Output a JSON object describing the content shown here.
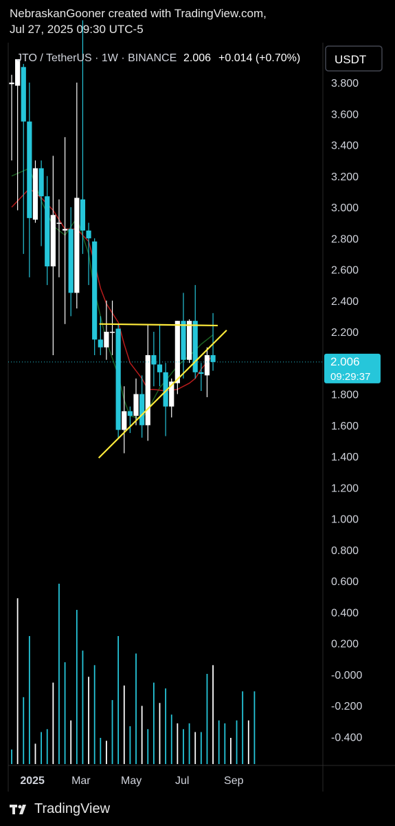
{
  "header": {
    "attribution": "NebraskanGooner created with TradingView.com,",
    "timestamp": "Jul 27, 2025 09:30 UTC-5"
  },
  "legend": {
    "symbol_text": "JTO / TetherUS · 1W · BINANCE",
    "last": "2.006",
    "change": "+0.014 (+0.70%)"
  },
  "currency_button": "USDT",
  "price_label": {
    "value": "2.006",
    "countdown": "09:29:37"
  },
  "footer": {
    "brand": "TradingView"
  },
  "colors": {
    "up": "#26c6da",
    "down": "#ffffff",
    "ma_red": "#b71c1c",
    "ma_green": "#1b5e20",
    "trendline": "#ffeb3b",
    "axis_text": "#d1d4dc",
    "background": "#000000"
  },
  "chart_data": {
    "type": "candlestick",
    "symbol": "JTO / TetherUS",
    "interval": "1W",
    "exchange": "BINANCE",
    "y_ticks": [
      "3.800",
      "3.600",
      "3.400",
      "3.200",
      "3.000",
      "2.800",
      "2.600",
      "2.400",
      "2.200",
      "2.000",
      "1.800",
      "1.600",
      "1.400",
      "1.200",
      "1.000",
      "0.800",
      "0.600",
      "0.400",
      "0.200",
      "-0.000",
      "-0.200",
      "-0.400"
    ],
    "ylim": [
      -0.55,
      4.0
    ],
    "x_ticks": [
      {
        "label": "2025",
        "week": 3.5
      },
      {
        "label": "Mar",
        "week": 11.7
      },
      {
        "label": "May",
        "week": 20.2
      },
      {
        "label": "Jul",
        "week": 28.8
      },
      {
        "label": "Sep",
        "week": 37.5
      }
    ],
    "candles": [
      {
        "w": 0,
        "o": 3.79,
        "h": 3.85,
        "l": 3.3,
        "c": 3.8
      },
      {
        "w": 1,
        "o": 3.78,
        "h": 3.9,
        "l": 2.98,
        "c": 3.95
      },
      {
        "w": 2,
        "o": 3.9,
        "h": 3.92,
        "l": 2.7,
        "c": 3.55
      },
      {
        "w": 3,
        "o": 3.55,
        "h": 3.8,
        "l": 2.55,
        "c": 2.93
      },
      {
        "w": 4,
        "o": 2.92,
        "h": 3.3,
        "l": 2.9,
        "c": 3.25
      },
      {
        "w": 5,
        "o": 3.25,
        "h": 3.3,
        "l": 2.75,
        "c": 3.07
      },
      {
        "w": 6,
        "o": 3.07,
        "h": 3.2,
        "l": 2.5,
        "c": 2.62
      },
      {
        "w": 7,
        "o": 2.62,
        "h": 3.33,
        "l": 2.05,
        "c": 2.95
      },
      {
        "w": 8,
        "o": 2.9,
        "h": 3.05,
        "l": 2.55,
        "c": 2.9
      },
      {
        "w": 9,
        "o": 2.85,
        "h": 3.45,
        "l": 2.25,
        "c": 2.86
      },
      {
        "w": 10,
        "o": 2.86,
        "h": 3.0,
        "l": 2.3,
        "c": 2.45
      },
      {
        "w": 11,
        "o": 2.45,
        "h": 3.8,
        "l": 2.35,
        "c": 3.06
      },
      {
        "w": 12,
        "o": 3.05,
        "h": 4.2,
        "l": 2.7,
        "c": 2.85
      },
      {
        "w": 13,
        "o": 2.85,
        "h": 2.9,
        "l": 2.5,
        "c": 2.8
      },
      {
        "w": 14,
        "o": 2.78,
        "h": 2.8,
        "l": 2.05,
        "c": 2.15
      },
      {
        "w": 15,
        "o": 2.15,
        "h": 2.3,
        "l": 2.05,
        "c": 2.1
      },
      {
        "w": 16,
        "o": 2.1,
        "h": 2.4,
        "l": 2.02,
        "c": 2.2
      },
      {
        "w": 17,
        "o": 2.2,
        "h": 2.4,
        "l": 2.05,
        "c": 2.2
      },
      {
        "w": 18,
        "o": 2.22,
        "h": 2.25,
        "l": 1.52,
        "c": 1.57
      },
      {
        "w": 19,
        "o": 1.57,
        "h": 1.85,
        "l": 1.42,
        "c": 1.69
      },
      {
        "w": 20,
        "o": 1.69,
        "h": 1.72,
        "l": 1.55,
        "c": 1.66
      },
      {
        "w": 21,
        "o": 1.66,
        "h": 1.9,
        "l": 1.6,
        "c": 1.8
      },
      {
        "w": 22,
        "o": 1.8,
        "h": 1.92,
        "l": 1.52,
        "c": 1.6
      },
      {
        "w": 23,
        "o": 1.6,
        "h": 2.25,
        "l": 1.5,
        "c": 2.05
      },
      {
        "w": 24,
        "o": 2.05,
        "h": 2.2,
        "l": 1.85,
        "c": 1.99
      },
      {
        "w": 25,
        "o": 1.99,
        "h": 2.25,
        "l": 1.85,
        "c": 1.94
      },
      {
        "w": 26,
        "o": 1.94,
        "h": 2.0,
        "l": 1.53,
        "c": 1.72
      },
      {
        "w": 27,
        "o": 1.72,
        "h": 1.9,
        "l": 1.65,
        "c": 1.88
      },
      {
        "w": 28,
        "o": 1.87,
        "h": 2.27,
        "l": 1.8,
        "c": 2.27
      },
      {
        "w": 29,
        "o": 2.27,
        "h": 2.45,
        "l": 1.9,
        "c": 2.02
      },
      {
        "w": 30,
        "o": 2.02,
        "h": 2.28,
        "l": 2.0,
        "c": 2.27
      },
      {
        "w": 31,
        "o": 2.27,
        "h": 2.5,
        "l": 1.9,
        "c": 1.94
      },
      {
        "w": 32,
        "o": 1.94,
        "h": 2.0,
        "l": 1.82,
        "c": 1.93
      },
      {
        "w": 33,
        "o": 1.92,
        "h": 2.1,
        "l": 1.78,
        "c": 2.05
      },
      {
        "w": 34,
        "o": 2.05,
        "h": 2.32,
        "l": 1.95,
        "c": 2.006
      }
    ],
    "volume": [
      0.05,
      0.57,
      0.23,
      0.44,
      0.07,
      0.11,
      0.12,
      0.28,
      0.62,
      0.35,
      0.15,
      0.53,
      0.39,
      0.3,
      0.34,
      0.09,
      0.08,
      0.22,
      0.44,
      0.27,
      0.13,
      0.38,
      0.2,
      0.12,
      0.28,
      0.21,
      0.26,
      0.17,
      0.14,
      0.12,
      0.14,
      0.11,
      0.11,
      0.31,
      0.34,
      0.15,
      0.14,
      0.09,
      0.15,
      0.25,
      0.15,
      0.25
    ],
    "ma_red": [
      [
        0,
        3.0
      ],
      [
        3,
        3.12
      ],
      [
        5,
        3.06
      ],
      [
        7,
        2.98
      ],
      [
        9,
        2.86
      ],
      [
        11,
        2.86
      ],
      [
        13,
        2.78
      ],
      [
        14,
        2.64
      ],
      [
        15,
        2.48
      ],
      [
        16,
        2.38
      ],
      [
        18,
        2.26
      ],
      [
        19,
        2.12
      ],
      [
        20,
        2.0
      ],
      [
        22,
        1.9
      ],
      [
        23,
        1.83
      ],
      [
        24,
        1.83
      ],
      [
        26,
        1.82
      ],
      [
        28,
        1.83
      ],
      [
        30,
        1.87
      ],
      [
        31,
        1.9
      ],
      [
        32,
        1.96
      ],
      [
        34,
        2.05
      ]
    ],
    "ma_green": [
      [
        0,
        3.2
      ],
      [
        3,
        3.25
      ],
      [
        5,
        3.04
      ],
      [
        7,
        2.88
      ],
      [
        9,
        2.82
      ],
      [
        11,
        2.93
      ],
      [
        13,
        2.7
      ],
      [
        14,
        2.46
      ],
      [
        15,
        2.3
      ],
      [
        16,
        2.14
      ],
      [
        18,
        1.92
      ],
      [
        19,
        1.76
      ],
      [
        20,
        1.66
      ],
      [
        22,
        1.64
      ],
      [
        23,
        1.7
      ],
      [
        25,
        1.84
      ],
      [
        28,
        1.98
      ],
      [
        31,
        2.08
      ],
      [
        32,
        2.12
      ],
      [
        34,
        2.18
      ]
    ],
    "trendlines": [
      {
        "name": "resistance",
        "points": [
          [
            14.8,
            2.25
          ],
          [
            34.8,
            2.24
          ]
        ]
      },
      {
        "name": "support",
        "points": [
          [
            14.7,
            1.39
          ],
          [
            36.3,
            2.21
          ]
        ]
      }
    ],
    "current_price": 2.006
  }
}
